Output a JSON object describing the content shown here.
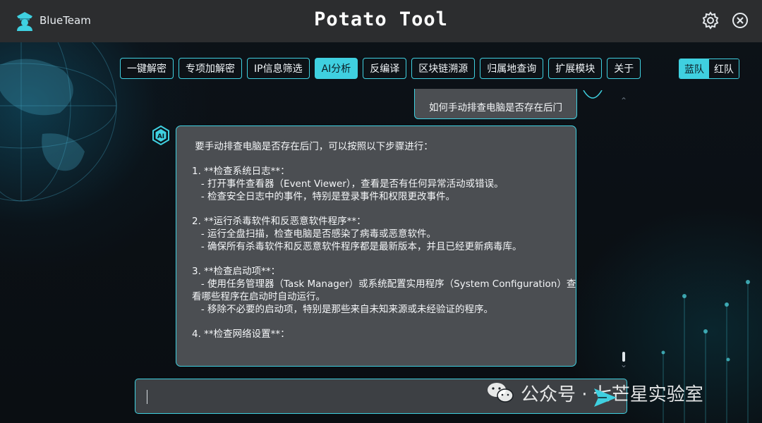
{
  "app": {
    "brand": "BlueTeam",
    "title": "Potato Tool"
  },
  "colors": {
    "accent": "#3fd0e0",
    "titlebar": "#2c2d2f",
    "bubble": "#4b4e52",
    "background": "#0b0f14"
  },
  "icons": {
    "logo": "police-officer-icon",
    "settings": "gear-icon",
    "close": "close-circle-icon",
    "ai_avatar": "ai-badge-icon",
    "send": "send-icon",
    "watermark": "wechat-icon"
  },
  "nav": {
    "items": [
      {
        "label": "一键解密",
        "active": false
      },
      {
        "label": "专项加解密",
        "active": false
      },
      {
        "label": "IP信息筛选",
        "active": false
      },
      {
        "label": "AI分析",
        "active": true
      },
      {
        "label": "反编译",
        "active": false
      },
      {
        "label": "区块链溯源",
        "active": false
      },
      {
        "label": "归属地查询",
        "active": false
      },
      {
        "label": "扩展模块",
        "active": false
      },
      {
        "label": "关于",
        "active": false
      }
    ],
    "team_toggle": {
      "blue": "蓝队",
      "red": "红队",
      "selected": "蓝队"
    }
  },
  "chat": {
    "user_message": "如何手动排查电脑是否存在后门",
    "ai_response_lines": [
      " 要手动排查电脑是否存在后门，可以按照以下步骤进行：",
      "",
      "1. **检查系统日志**：",
      "   - 打开事件查看器（Event Viewer），查看是否有任何异常活动或错误。",
      "   - 检查安全日志中的事件，特别是登录事件和权限更改事件。",
      "",
      "2. **运行杀毒软件和反恶意软件程序**：",
      "   - 运行全盘扫描，检查电脑是否感染了病毒或恶意软件。",
      "   - 确保所有杀毒软件和反恶意软件程序都是最新版本，并且已经更新病毒库。",
      "",
      "3. **检查启动项**：",
      "   - 使用任务管理器（Task Manager）或系统配置实用程序（System Configuration）查",
      "看哪些程序在启动时自动运行。",
      "   - 移除不必要的启动项，特别是那些来自未知来源或未经验证的程序。",
      "",
      "4. **检查网络设置**："
    ],
    "input_value": ""
  },
  "watermark": {
    "text": "公众号 · 七芒星实验室"
  }
}
